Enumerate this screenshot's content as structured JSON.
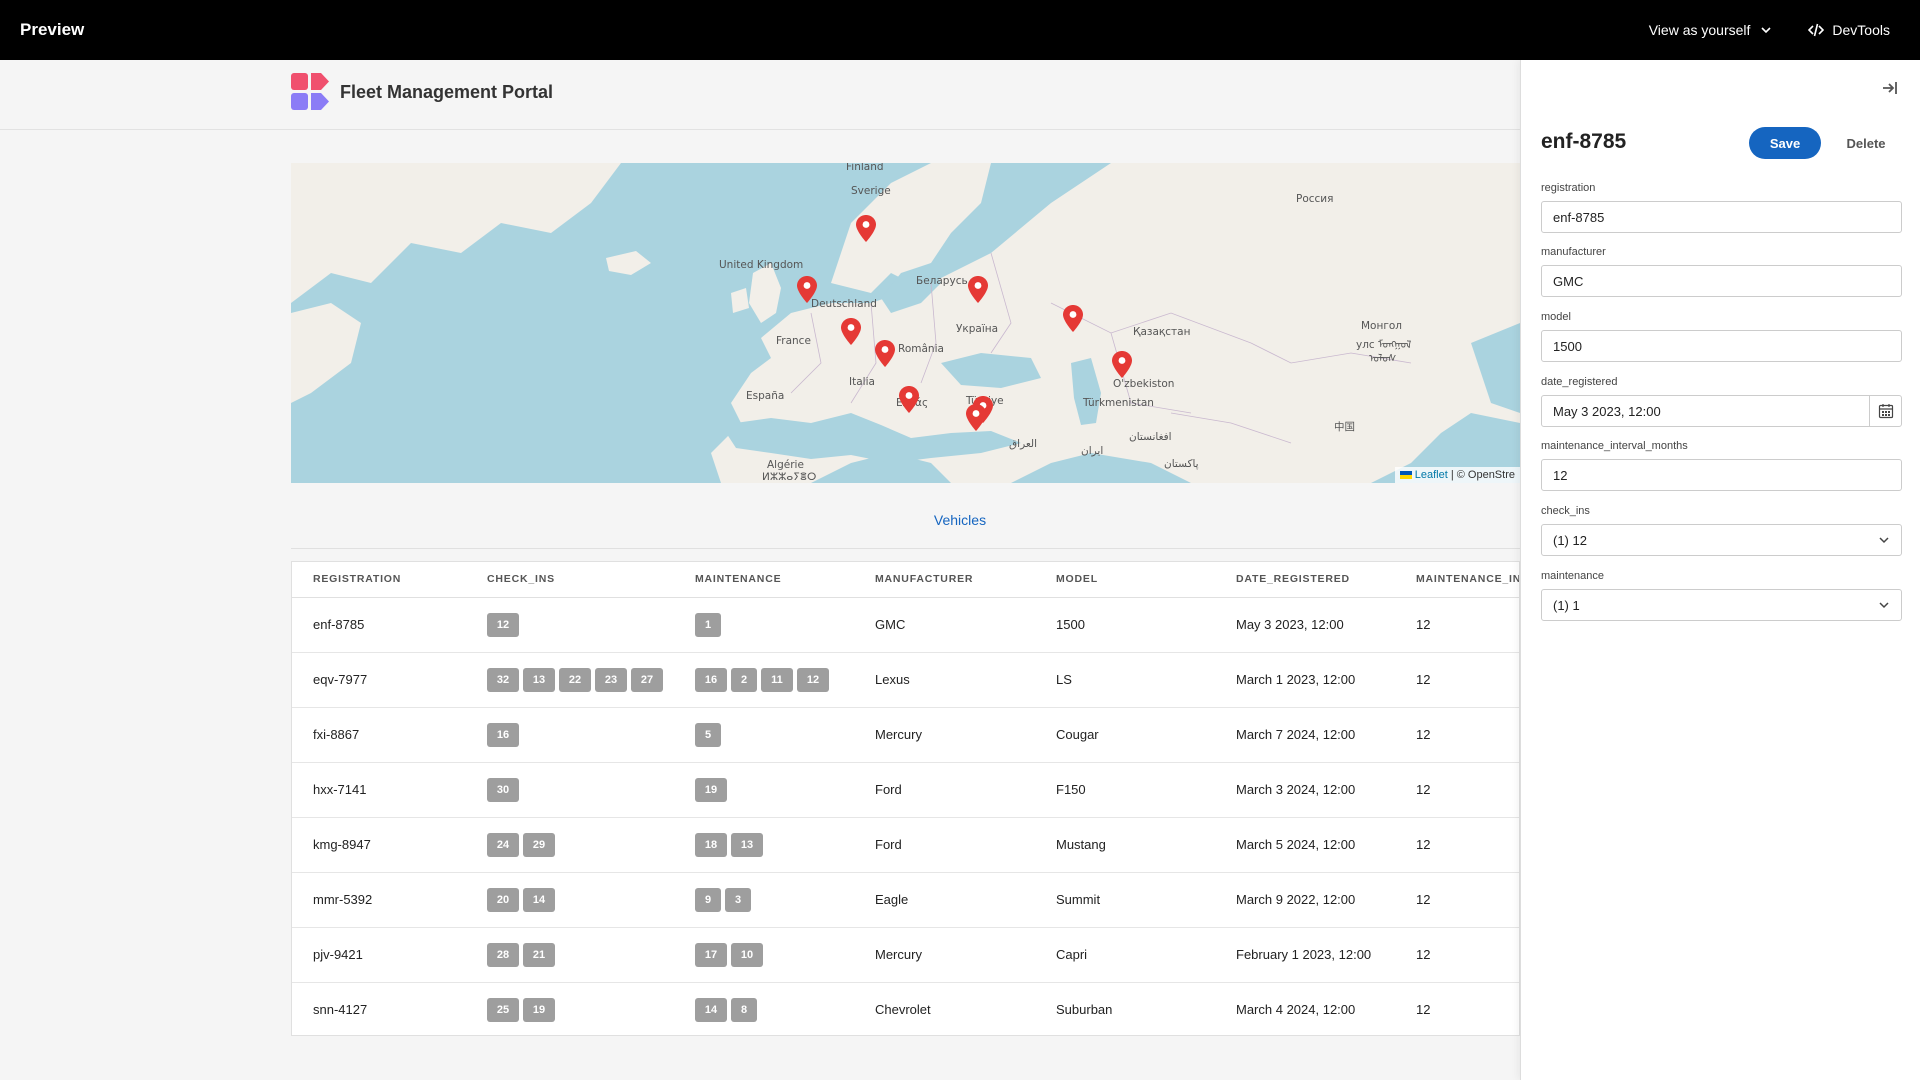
{
  "topbar": {
    "title": "Preview",
    "view_as": "View as yourself",
    "devtools": "DevTools"
  },
  "app": {
    "title": "Fleet Management Portal"
  },
  "map": {
    "labels": [
      {
        "text": "Sverige"
      },
      {
        "text": "Россия"
      },
      {
        "text": "United Kingdom"
      },
      {
        "text": "Беларусь"
      },
      {
        "text": "Deutschland"
      },
      {
        "text": "Україна"
      },
      {
        "text": "France"
      },
      {
        "text": "România"
      },
      {
        "text": "Қазақстан"
      },
      {
        "text": "Монгол"
      },
      {
        "text": "улс ᠮᠤᠩᠭᠤᠯ"
      },
      {
        "text": "ᠤᠯᠤᠰ"
      },
      {
        "text": "Italia"
      },
      {
        "text": "O'zbekiston"
      },
      {
        "text": "España"
      },
      {
        "text": "Ελλάς"
      },
      {
        "text": "Türkiye"
      },
      {
        "text": "Türkmenistan"
      },
      {
        "text": "中国"
      },
      {
        "text": "افغانستان"
      },
      {
        "text": "العراق"
      },
      {
        "text": "ایران"
      },
      {
        "text": "پاکستان"
      },
      {
        "text": "Algérie"
      },
      {
        "text": "ⵍⵣⵣⴰⵢⴻⵔ"
      },
      {
        "text": "Finland"
      }
    ],
    "attribution_link": "Leaflet",
    "attribution_text": "| © OpenStre"
  },
  "vehicles_link": "Vehicles",
  "table": {
    "columns": [
      "REGISTRATION",
      "CHECK_INS",
      "MAINTENANCE",
      "MANUFACTURER",
      "MODEL",
      "DATE_REGISTERED",
      "MAINTENANCE_INT"
    ],
    "rows": [
      {
        "registration": "enf-8785",
        "check_ins": [
          "12"
        ],
        "maintenance": [
          "1"
        ],
        "manufacturer": "GMC",
        "model": "1500",
        "date_registered": "May 3 2023, 12:00",
        "interval": "12"
      },
      {
        "registration": "eqv-7977",
        "check_ins": [
          "32",
          "13",
          "22",
          "23",
          "27"
        ],
        "maintenance": [
          "16",
          "2",
          "11",
          "12"
        ],
        "manufacturer": "Lexus",
        "model": "LS",
        "date_registered": "March 1 2023, 12:00",
        "interval": "12"
      },
      {
        "registration": "fxi-8867",
        "check_ins": [
          "16"
        ],
        "maintenance": [
          "5"
        ],
        "manufacturer": "Mercury",
        "model": "Cougar",
        "date_registered": "March 7 2024, 12:00",
        "interval": "12"
      },
      {
        "registration": "hxx-7141",
        "check_ins": [
          "30"
        ],
        "maintenance": [
          "19"
        ],
        "manufacturer": "Ford",
        "model": "F150",
        "date_registered": "March 3 2024, 12:00",
        "interval": "12"
      },
      {
        "registration": "kmg-8947",
        "check_ins": [
          "24",
          "29"
        ],
        "maintenance": [
          "18",
          "13"
        ],
        "manufacturer": "Ford",
        "model": "Mustang",
        "date_registered": "March 5 2024, 12:00",
        "interval": "12"
      },
      {
        "registration": "mmr-5392",
        "check_ins": [
          "20",
          "14"
        ],
        "maintenance": [
          "9",
          "3"
        ],
        "manufacturer": "Eagle",
        "model": "Summit",
        "date_registered": "March 9 2022, 12:00",
        "interval": "12"
      },
      {
        "registration": "pjv-9421",
        "check_ins": [
          "28",
          "21"
        ],
        "maintenance": [
          "17",
          "10"
        ],
        "manufacturer": "Mercury",
        "model": "Capri",
        "date_registered": "February 1 2023, 12:00",
        "interval": "12"
      },
      {
        "registration": "snn-4127",
        "check_ins": [
          "25",
          "19"
        ],
        "maintenance": [
          "14",
          "8"
        ],
        "manufacturer": "Chevrolet",
        "model": "Suburban",
        "date_registered": "March 4 2024, 12:00",
        "interval": "12"
      }
    ]
  },
  "panel": {
    "title": "enf-8785",
    "save_label": "Save",
    "delete_label": "Delete",
    "fields": {
      "registration": {
        "label": "registration",
        "value": "enf-8785"
      },
      "manufacturer": {
        "label": "manufacturer",
        "value": "GMC"
      },
      "model": {
        "label": "model",
        "value": "1500"
      },
      "date_registered": {
        "label": "date_registered",
        "value": "May 3 2023, 12:00"
      },
      "maintenance_interval_months": {
        "label": "maintenance_interval_months",
        "value": "12"
      },
      "check_ins": {
        "label": "check_ins",
        "value": "(1) 12"
      },
      "maintenance": {
        "label": "maintenance",
        "value": "(1) 1"
      }
    }
  },
  "colors": {
    "accent": "#1565c0",
    "marker": "#e53935",
    "badge": "#9e9e9e",
    "water": "#aad3df",
    "land": "#f2efe9"
  },
  "icons": {
    "view_as_chevron": "chevron-down-icon",
    "devtools": "code-icon",
    "panel_collapse": "collapse-right-icon",
    "calendar": "calendar-icon",
    "select_chevron": "chevron-down-icon",
    "map_marker": "map-marker-icon"
  }
}
